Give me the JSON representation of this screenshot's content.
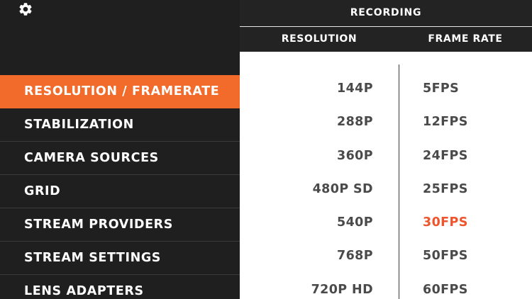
{
  "colors": {
    "accent": "#f26b2a",
    "selected_text": "#f0542c",
    "sidebar_bg": "#1f1f1f",
    "panel_bg": "#ffffff"
  },
  "settings_icon": "gear-icon",
  "sidebar": {
    "items": [
      {
        "label": "RESOLUTION / FRAMERATE",
        "active": true
      },
      {
        "label": "STABILIZATION"
      },
      {
        "label": "CAMERA SOURCES"
      },
      {
        "label": "GRID"
      },
      {
        "label": "STREAM PROVIDERS"
      },
      {
        "label": "STREAM SETTINGS"
      },
      {
        "label": "LENS ADAPTERS"
      }
    ]
  },
  "header": {
    "title": "RECORDING",
    "resolution_label": "RESOLUTION",
    "framerate_label": "FRAME RATE"
  },
  "resolutions": [
    "144P",
    "288P",
    "360P",
    "480P SD",
    "540P",
    "768P",
    "720P HD"
  ],
  "framerates": [
    "5FPS",
    "12FPS",
    "24FPS",
    "25FPS",
    "30FPS",
    "50FPS",
    "60FPS"
  ],
  "selected_framerate": "30FPS"
}
